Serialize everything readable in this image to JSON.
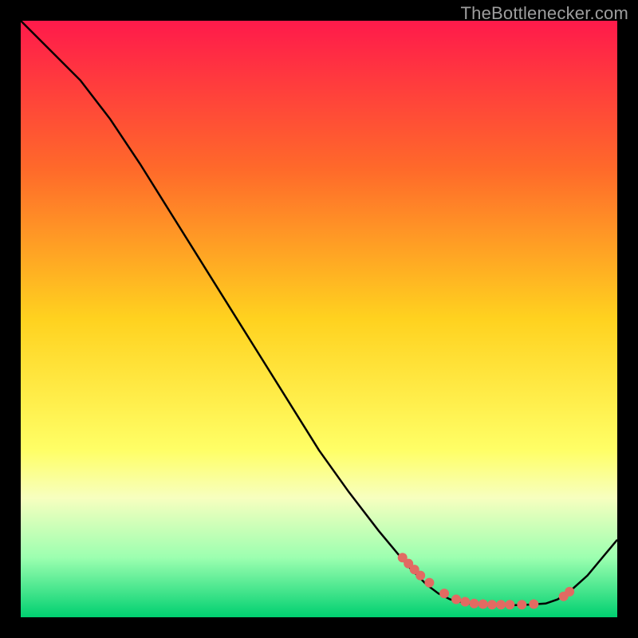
{
  "watermark": "TheBottlenecker.com",
  "chart_data": {
    "type": "line",
    "title": "",
    "xlabel": "",
    "ylabel": "",
    "xlim": [
      0,
      100
    ],
    "ylim": [
      0,
      100
    ],
    "grid": false,
    "gradient_stops": [
      {
        "offset": 0,
        "color": "#ff1a4b"
      },
      {
        "offset": 25,
        "color": "#ff6a2a"
      },
      {
        "offset": 50,
        "color": "#ffd21f"
      },
      {
        "offset": 72,
        "color": "#ffff66"
      },
      {
        "offset": 80,
        "color": "#f7ffbf"
      },
      {
        "offset": 90,
        "color": "#9cffb0"
      },
      {
        "offset": 100,
        "color": "#00d070"
      }
    ],
    "series": [
      {
        "name": "curve",
        "color": "#000000",
        "x": [
          0,
          5,
          10,
          15,
          20,
          25,
          30,
          35,
          40,
          45,
          50,
          55,
          60,
          65,
          68,
          70,
          72,
          75,
          78,
          80,
          82,
          85,
          88,
          90,
          92,
          95,
          100
        ],
        "y": [
          100,
          95,
          90,
          83.5,
          76,
          68,
          60,
          52,
          44,
          36,
          28,
          21,
          14.5,
          8.5,
          5.5,
          4,
          3,
          2.3,
          2,
          2,
          2,
          2.1,
          2.3,
          3,
          4.3,
          7,
          13
        ]
      }
    ],
    "markers": {
      "name": "highlight-dots",
      "color": "#e26a62",
      "radius": 6,
      "x": [
        64,
        65,
        66,
        67,
        68.5,
        71,
        73,
        74.5,
        76,
        77.5,
        79,
        80.5,
        82,
        84,
        86,
        91,
        92
      ],
      "y": [
        10,
        9,
        8,
        7,
        5.8,
        4,
        3,
        2.6,
        2.3,
        2.2,
        2.1,
        2.1,
        2.1,
        2.1,
        2.2,
        3.5,
        4.3
      ]
    }
  }
}
